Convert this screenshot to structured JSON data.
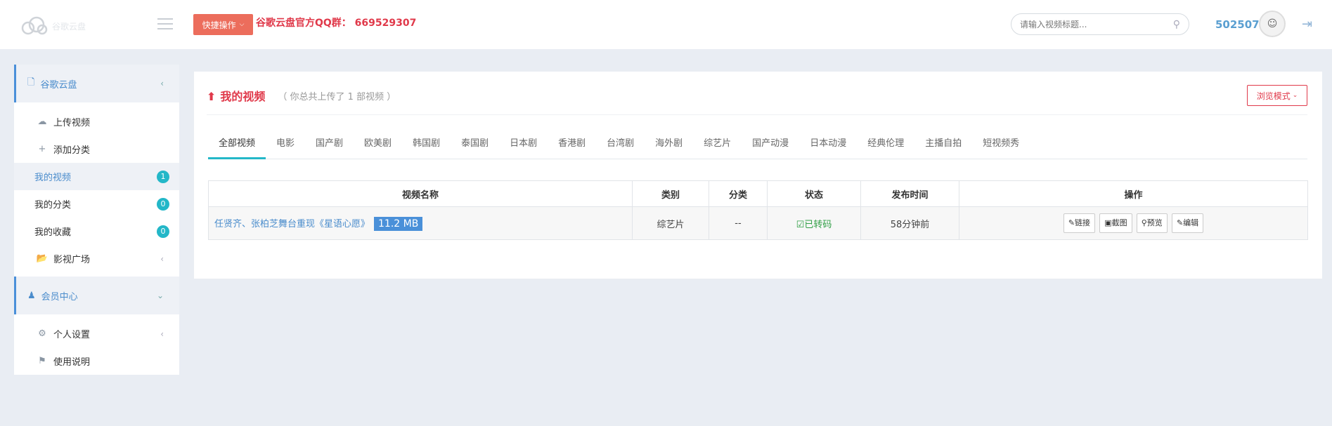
{
  "header": {
    "logo_text": "谷歌云盘",
    "quick_label": "快捷操作",
    "qq_note": "谷歌云盘官方QQ群： 669529307",
    "search_placeholder": "请输入视频标题...",
    "user_id": "502507"
  },
  "sidebar": {
    "group1": "谷歌云盘",
    "items": [
      {
        "label": "上传视频"
      },
      {
        "label": "添加分类"
      },
      {
        "label": "我的视频",
        "badge": "1"
      },
      {
        "label": "我的分类",
        "badge": "0"
      },
      {
        "label": "我的收藏",
        "badge": "0"
      },
      {
        "label": "影视广场"
      }
    ],
    "group2": "会员中心",
    "items2": [
      {
        "label": "个人设置"
      },
      {
        "label": "使用说明"
      }
    ]
  },
  "panel": {
    "title": "我的视频",
    "subtitle": "（ 你总共上传了 1 部视频 ）",
    "browse_label": "浏览模式"
  },
  "tabs": [
    "全部视频",
    "电影",
    "国产剧",
    "欧美剧",
    "韩国剧",
    "泰国剧",
    "日本剧",
    "香港剧",
    "台湾剧",
    "海外剧",
    "综艺片",
    "国产动漫",
    "日本动漫",
    "经典伦理",
    "主播自拍",
    "短视频秀"
  ],
  "table": {
    "headers": [
      "视频名称",
      "类别",
      "分类",
      "状态",
      "发布时间",
      "操作"
    ],
    "rows": [
      {
        "name": "任贤齐、张柏芝舞台重现《星语心愿》",
        "size": "11.2 MB",
        "type": "综艺片",
        "category": "--",
        "status": "已转码",
        "time": "58分钟前",
        "ops": [
          "链接",
          "截图",
          "预览",
          "编辑"
        ]
      }
    ]
  }
}
